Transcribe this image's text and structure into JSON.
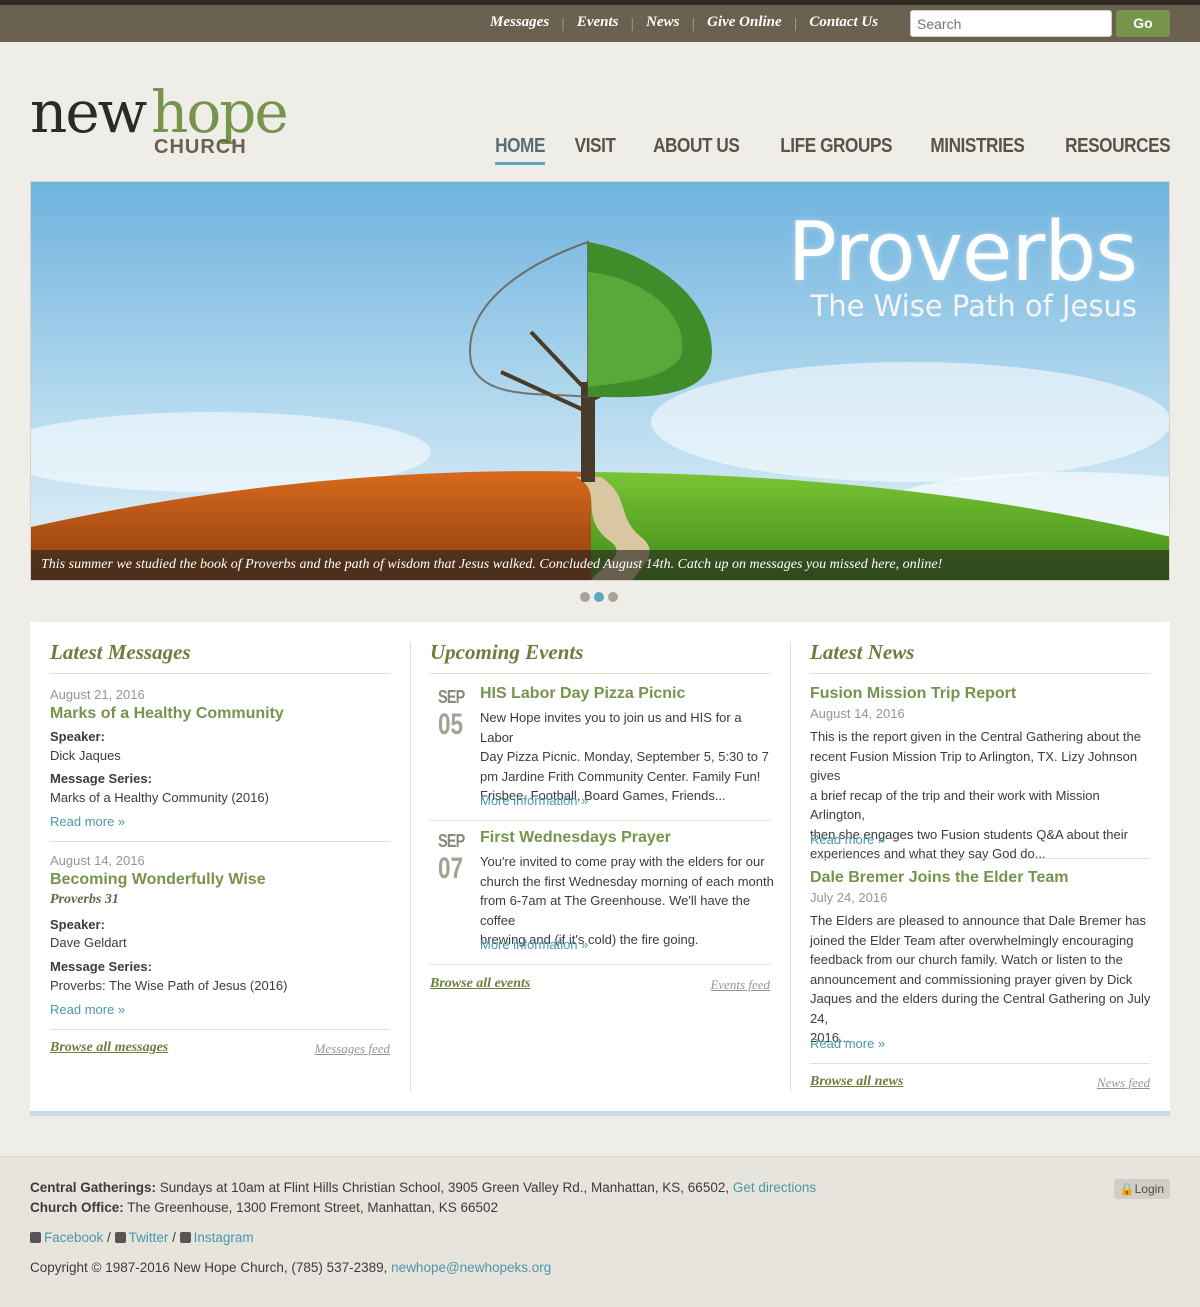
{
  "topnav": {
    "links": [
      "Messages",
      "Events",
      "News",
      "Give Online",
      "Contact Us"
    ],
    "search_placeholder": "Search",
    "go_label": "Go"
  },
  "logo": {
    "word1": "new",
    "word2": "hope",
    "word3": "CHURCH"
  },
  "mainnav": [
    "HOME",
    "VISIT",
    "ABOUT US",
    "LIFE GROUPS",
    "MINISTRIES",
    "RESOURCES"
  ],
  "hero": {
    "title": "Proverbs",
    "subtitle": "The Wise Path of Jesus",
    "caption": "This summer we studied the book of Proverbs and the path of wisdom that Jesus walked. Concluded August 14th. Catch up on messages you missed here, online!",
    "slide_count": 3,
    "active_slide": 2
  },
  "messages": {
    "heading": "Latest Messages",
    "items": [
      {
        "date": "August 21, 2016",
        "title": "Marks of a Healthy Community",
        "subtitle": "",
        "speaker_label": "Speaker:",
        "speaker": "Dick Jaques",
        "series_label": "Message Series:",
        "series": "Marks of a Healthy Community (2016)",
        "more": "Read more »"
      },
      {
        "date": "August 14, 2016",
        "title": "Becoming Wonderfully Wise",
        "subtitle": "Proverbs 31",
        "speaker_label": "Speaker:",
        "speaker": "Dave Geldart",
        "series_label": "Message Series:",
        "series": "Proverbs: The Wise Path of Jesus (2016)",
        "more": "Read more »"
      }
    ],
    "browse": "Browse all messages",
    "feed": "Messages feed"
  },
  "events": {
    "heading": "Upcoming Events",
    "items": [
      {
        "month": "SEP",
        "day": "05",
        "title": "HIS Labor Day Pizza Picnic",
        "lines": [
          "New Hope invites you to join us and HIS for a Labor",
          "Day Pizza Picnic.  Monday, September 5, 5:30 to 7",
          "pm Jardine Frith Community Center.  Family Fun!",
          " Frisbee, Football, Board Games, Friends..."
        ],
        "more": "More information »"
      },
      {
        "month": "SEP",
        "day": "07",
        "title": "First Wednesdays Prayer",
        "lines": [
          "You're invited to come pray with the elders for our",
          "church the first Wednesday morning of each month",
          "from 6-7am at The Greenhouse.  We'll have the coffee",
          "brewing and (if it's cold) the fire going."
        ],
        "more": "More information »"
      }
    ],
    "browse": "Browse all events",
    "feed": "Events feed"
  },
  "news": {
    "heading": "Latest News",
    "items": [
      {
        "title": "Fusion Mission Trip Report",
        "date": "August 14, 2016",
        "lines": [
          "This is the report given in the Central Gathering about the",
          "recent Fusion Mission Trip to Arlington, TX.  Lizy Johnson gives",
          "a brief recap of the trip and their work with Mission Arlington,",
          "then she engages two Fusion students Q&A about their",
          "experiences and what they say God do..."
        ],
        "more": "Read more »"
      },
      {
        "title": "Dale Bremer Joins the Elder Team",
        "date": "July 24, 2016",
        "lines": [
          "The Elders are pleased to announce that Dale Bremer has",
          "joined the Elder Team after overwhelmingly encouraging",
          "feedback from our church family.  Watch or listen to the",
          "announcement and commissioning prayer given by Dick",
          "Jaques and the elders during the Central Gathering on July 24,",
          "2016..."
        ],
        "more": "Read more »"
      }
    ],
    "browse": "Browse all news",
    "feed": "News feed"
  },
  "footer": {
    "gatherings_label": "Central Gatherings:",
    "gatherings_text": " Sundays at 10am at Flint Hills Christian School, 3905 Green Valley Rd., Manhattan, KS, 66502, ",
    "directions": "Get directions",
    "office_label": "Church Office:",
    "office_text": " The Greenhouse, 1300 Fremont Street, Manhattan, KS 66502",
    "facebook": "Facebook",
    "twitter": "Twitter",
    "instagram": "Instagram",
    "copyright": "Copyright © 1987-2016 New Hope Church, (785) 537-2389, ",
    "email": "newhope@newhopeks.org",
    "login": "Login"
  },
  "colors": {
    "accent_green": "#77944c",
    "accent_teal": "#5ea8b8",
    "topbar": "#6b6150"
  }
}
